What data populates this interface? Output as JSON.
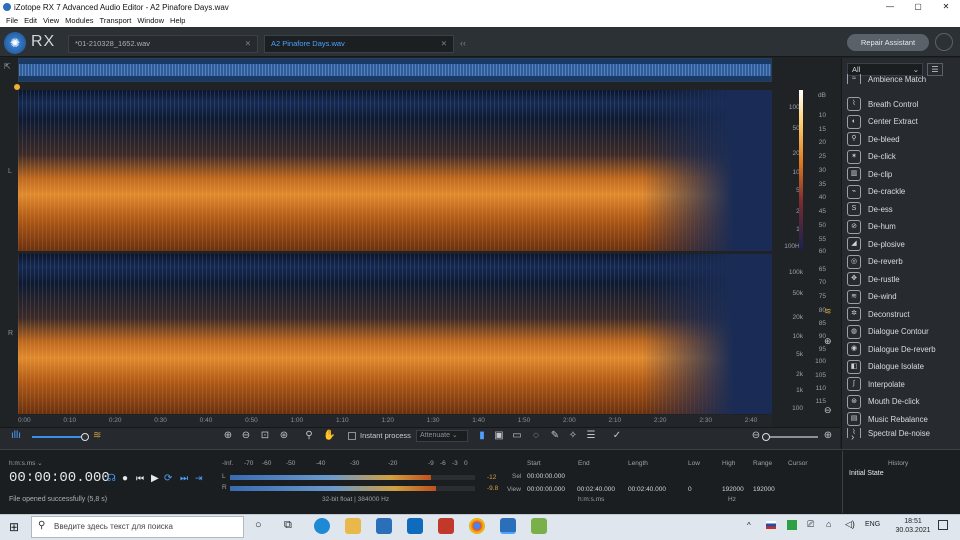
{
  "window": {
    "title": "iZotope RX 7 Advanced Audio Editor - A2 Pinafore Days.wav",
    "minimize": "—",
    "maximize": "▢",
    "close": "✕"
  },
  "menu": [
    "File",
    "Edit",
    "View",
    "Modules",
    "Transport",
    "Window",
    "Help"
  ],
  "app": {
    "logo_text": "RX",
    "repair_assistant": "Repair Assistant"
  },
  "tabs": [
    {
      "label": "*01-210328_1652.wav",
      "active": false
    },
    {
      "label": "A2 Pinafore Days.wav",
      "active": true
    }
  ],
  "channels": {
    "left": "L",
    "right": "R"
  },
  "freq_axis_top": [
    "100k",
    "50k",
    "20k",
    "10k",
    "5k",
    "2k",
    "1k",
    "100Hz"
  ],
  "freq_axis_bottom": [
    "100k",
    "50k",
    "20k",
    "10k",
    "5k",
    "2k",
    "1k",
    "100"
  ],
  "db_axis_top": [
    "dB",
    "10",
    "15",
    "20",
    "25",
    "30",
    "35",
    "40",
    "45",
    "50",
    "55",
    "60"
  ],
  "db_axis_bottom": [
    "65",
    "70",
    "75",
    "80",
    "85",
    "90",
    "95",
    "100",
    "105",
    "110",
    "115"
  ],
  "timeline": [
    "0:00",
    "0:10",
    "0:20",
    "0:30",
    "0:40",
    "0:50",
    "1:00",
    "1:10",
    "1:20",
    "1:30",
    "1:40",
    "1:50",
    "2:00",
    "2:10",
    "2:20",
    "2:30",
    "2:40"
  ],
  "toolbar": {
    "instant_process": "Instant process",
    "attenuate": "Attenuate"
  },
  "modules": {
    "filter": "All",
    "items": [
      "Ambience Match",
      "Breath Control",
      "Center Extract",
      "De-bleed",
      "De-click",
      "De-clip",
      "De-crackle",
      "De-ess",
      "De-hum",
      "De-plosive",
      "De-reverb",
      "De-rustle",
      "De-wind",
      "Deconstruct",
      "Dialogue Contour",
      "Dialogue De-reverb",
      "Dialogue Isolate",
      "Interpolate",
      "Mouth De-click",
      "Music Rebalance",
      "Spectral De-noise"
    ]
  },
  "transport": {
    "format": "h:m:s.ms",
    "timecode": "00:00:00.000",
    "status": "File opened successfully (5,8 s)"
  },
  "meter": {
    "scale": [
      "-Inf.",
      "-70",
      "-60",
      "-50",
      "-40",
      "-30",
      "-20",
      "-9",
      "-6",
      "-3",
      "0"
    ],
    "left_label": "L",
    "right_label": "R",
    "left_peak": "-12",
    "right_peak": "-9.8",
    "format": "32-bit float | 384000 Hz",
    "left_level": 0.82,
    "right_level": 0.84
  },
  "selection": {
    "headers": [
      "Start",
      "End",
      "Length",
      "Low",
      "High",
      "Range",
      "Cursor"
    ],
    "sel_label": "Sel",
    "view_label": "View",
    "sel_start": "00:00:00.000",
    "view_start": "00:00:00.000",
    "view_end": "00:02:40.000",
    "view_length": "00:02:40.000",
    "view_low": "0",
    "view_high": "192000",
    "view_range": "192000",
    "time_unit": "h:m:s.ms",
    "freq_unit": "Hz"
  },
  "history": {
    "title": "History",
    "items": [
      "Initial State"
    ]
  },
  "taskbar": {
    "search_placeholder": "Введите здесь текст для поиска",
    "lang": "ENG",
    "time": "18:51",
    "date": "30.03.2021"
  }
}
